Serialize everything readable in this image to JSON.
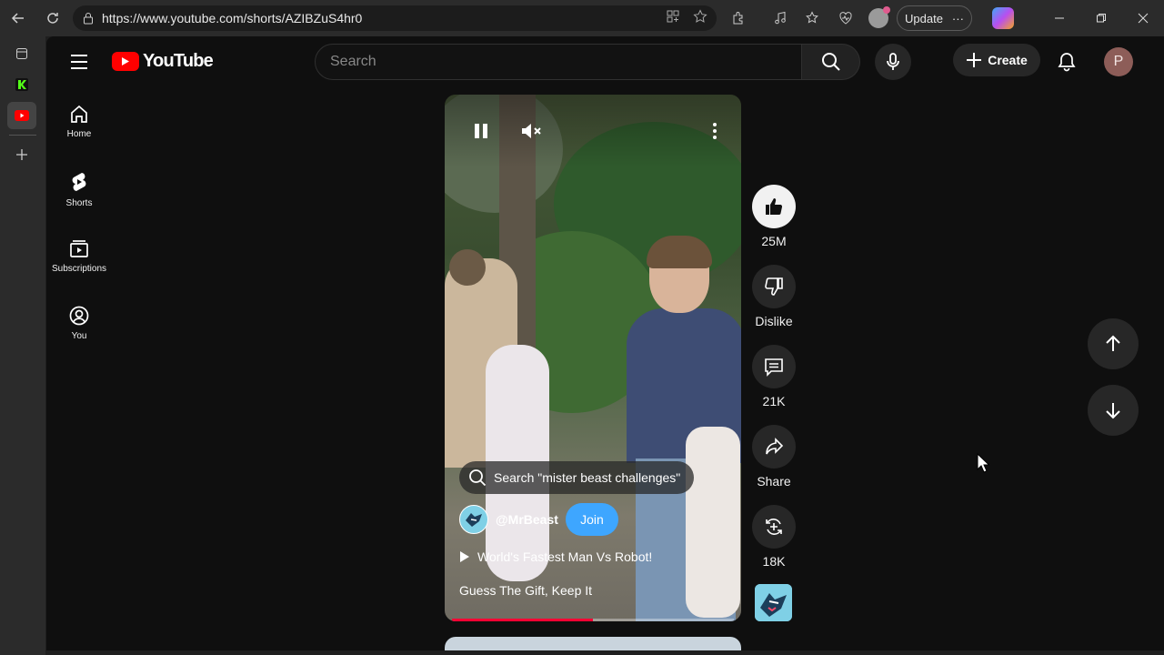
{
  "browser": {
    "url": "https://www.youtube.com/shorts/AZIBZuS4hr0",
    "update_label": "Update"
  },
  "header": {
    "logo_text": "YouTube",
    "search_placeholder": "Search",
    "create_label": "Create",
    "avatar_letter": "P"
  },
  "guide": {
    "items": [
      {
        "label": "Home",
        "icon": "home-icon"
      },
      {
        "label": "Shorts",
        "icon": "shorts-icon"
      },
      {
        "label": "Subscriptions",
        "icon": "subscriptions-icon"
      },
      {
        "label": "You",
        "icon": "you-icon"
      }
    ]
  },
  "video": {
    "search_chip": "Search \"mister beast challenges\"",
    "channel": "@MrBeast",
    "join_label": "Join",
    "playlist_title": "World's Fastest Man Vs Robot!",
    "title": "Guess The Gift, Keep It",
    "progress": 0.5
  },
  "actions": {
    "like_count": "25M",
    "dislike_label": "Dislike",
    "comment_count": "21K",
    "share_label": "Share",
    "remix_count": "18K"
  },
  "colors": {
    "brand_red": "#ff0000",
    "join_blue": "#3ea6ff",
    "progress_red": "#ff0033"
  }
}
